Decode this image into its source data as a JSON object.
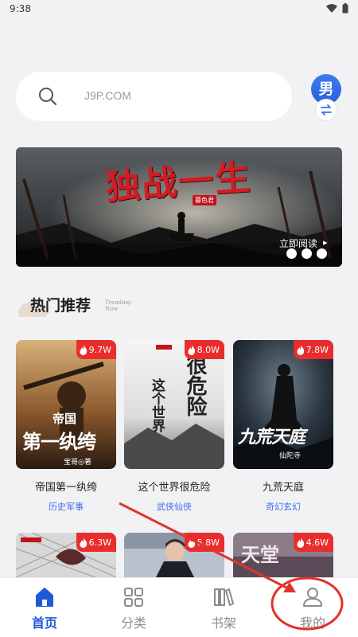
{
  "status_bar": {
    "time": "9:38"
  },
  "search": {
    "placeholder": "J9P.COM"
  },
  "gender_toggle": {
    "label": "男"
  },
  "banner": {
    "title": "独战一生",
    "badge": "暮色君",
    "cta": "立即阅读",
    "cta_arrow": "▸"
  },
  "section": {
    "title": "热门推荐",
    "subtitle": "Trending Now"
  },
  "books": [
    {
      "name": "帝国第一纨绔",
      "genre": "历史军事",
      "heat": "9.7W",
      "cover_text_a": "帝国",
      "cover_text_b": "第一纨绔",
      "author_tag": "宝哥◎著"
    },
    {
      "name": "这个世界很危险",
      "genre": "武侠仙侠",
      "heat": "8.0W",
      "cover_text_a": "很危险",
      "cover_text_b": "这个世界"
    },
    {
      "name": "九荒天庭",
      "genre": "奇幻玄幻",
      "heat": "7.8W",
      "cover_text_a": "九荒天庭",
      "author_tag": "仙陀寺"
    }
  ],
  "books_row2": [
    {
      "heat": "6.3W"
    },
    {
      "heat": "5.8W"
    },
    {
      "heat": "4.6W",
      "cover_text_a": "天堂"
    }
  ],
  "nav": {
    "items": [
      {
        "label": "首页",
        "icon": "home-icon",
        "active": true
      },
      {
        "label": "分类",
        "icon": "grid-icon",
        "active": false
      },
      {
        "label": "书架",
        "icon": "bookshelf-icon",
        "active": false
      },
      {
        "label": "我的",
        "icon": "user-icon",
        "active": false
      }
    ]
  },
  "colors": {
    "accent": "#1f58d9",
    "hot": "#e92d2d",
    "genre": "#3a6cf0",
    "annotation": "#e0342a"
  }
}
